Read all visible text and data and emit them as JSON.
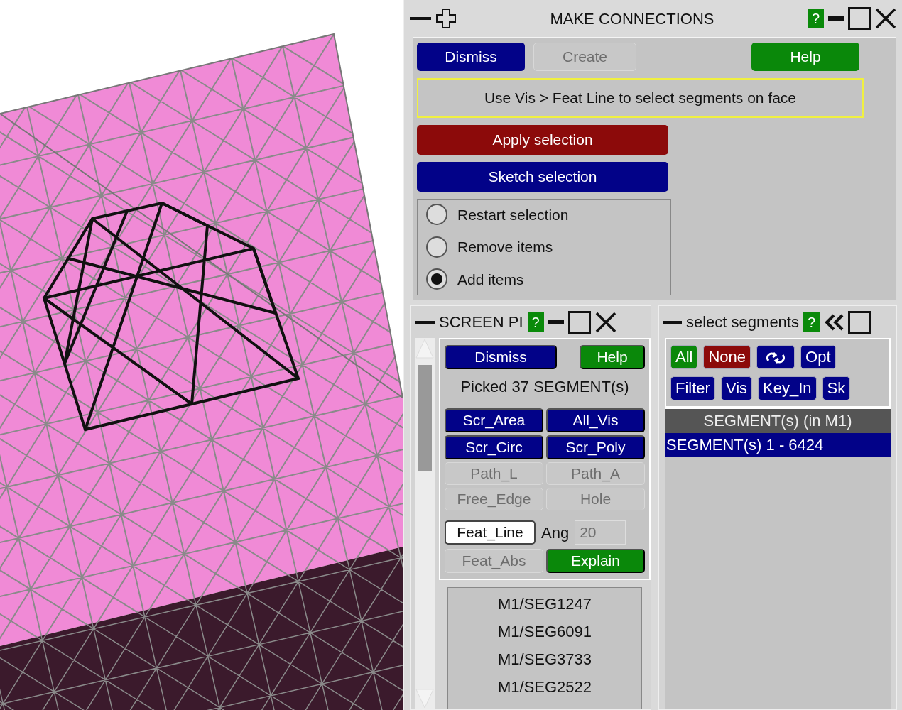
{
  "window": {
    "title": "MAKE CONNECTIONS"
  },
  "toolbar": [
    {
      "label": "Dismiss",
      "kind": "action",
      "disabled": false
    },
    {
      "label": "Create",
      "kind": "action",
      "disabled": true
    },
    {
      "label": "Help",
      "kind": "help",
      "disabled": false
    }
  ],
  "help_badge": "?",
  "hint": "Use Vis > Feat Line to select segments on face",
  "actions": [
    {
      "label": "Apply selection",
      "kind": "apply"
    },
    {
      "label": "Sketch selection",
      "kind": "action"
    }
  ],
  "modes": [
    {
      "label": "Restart selection",
      "selected": false
    },
    {
      "label": "Remove items",
      "selected": false
    },
    {
      "label": "Add items",
      "selected": true
    }
  ],
  "screen_pick": {
    "title": "SCREEN PI",
    "help_badge": "?",
    "buttons": [
      {
        "label": "Dismiss",
        "kind": "action"
      },
      {
        "label": "Help",
        "kind": "help"
      }
    ],
    "status": "Picked 37 SEGMENT(s)",
    "methods": [
      {
        "kind": "action",
        "label": "Scr_Area",
        "disabled": false
      },
      {
        "kind": "action",
        "label": "All_Vis",
        "disabled": false
      },
      {
        "kind": "action",
        "label": "Scr_Circ",
        "disabled": false
      },
      {
        "kind": "action",
        "label": "Scr_Poly",
        "disabled": false
      },
      {
        "kind": "action",
        "label": "Path_L",
        "disabled": true
      },
      {
        "kind": "action",
        "label": "Path_A",
        "disabled": true
      },
      {
        "kind": "action",
        "label": "Free_Edge",
        "disabled": true
      },
      {
        "kind": "action",
        "label": "Hole",
        "disabled": true
      }
    ],
    "feature_rows": [
      [
        {
          "kind": "toggle",
          "label": "Feat_Line",
          "disabled": false
        },
        {
          "kind": "label",
          "label": "Ang"
        },
        {
          "kind": "field",
          "value": "20",
          "disabled": true
        }
      ],
      [
        {
          "kind": "action",
          "label": "Feat_Abs",
          "disabled": true
        },
        {
          "kind": "help",
          "label": "Explain",
          "disabled": false
        }
      ]
    ],
    "picked": [
      "M1/SEG1247",
      "M1/SEG6091",
      "M1/SEG3733",
      "M1/SEG2522"
    ]
  },
  "select_segments": {
    "title": "select segments",
    "help_badge": "?",
    "button_rows": [
      [
        {
          "kind": "help",
          "label": "All"
        },
        {
          "kind": "apply",
          "label": "None"
        },
        {
          "kind": "swap"
        },
        {
          "kind": "action",
          "label": "Opt"
        }
      ],
      [
        {
          "kind": "action",
          "label": "Filter"
        },
        {
          "kind": "action",
          "label": "Vis"
        },
        {
          "kind": "action",
          "label": "Key_In"
        },
        {
          "kind": "action",
          "label": "Sk"
        }
      ]
    ],
    "list_header": "SEGMENT(s) (in M1)",
    "items": [
      {
        "label": "SEGMENT(s) 1 - 6424",
        "selected": true
      }
    ]
  }
}
